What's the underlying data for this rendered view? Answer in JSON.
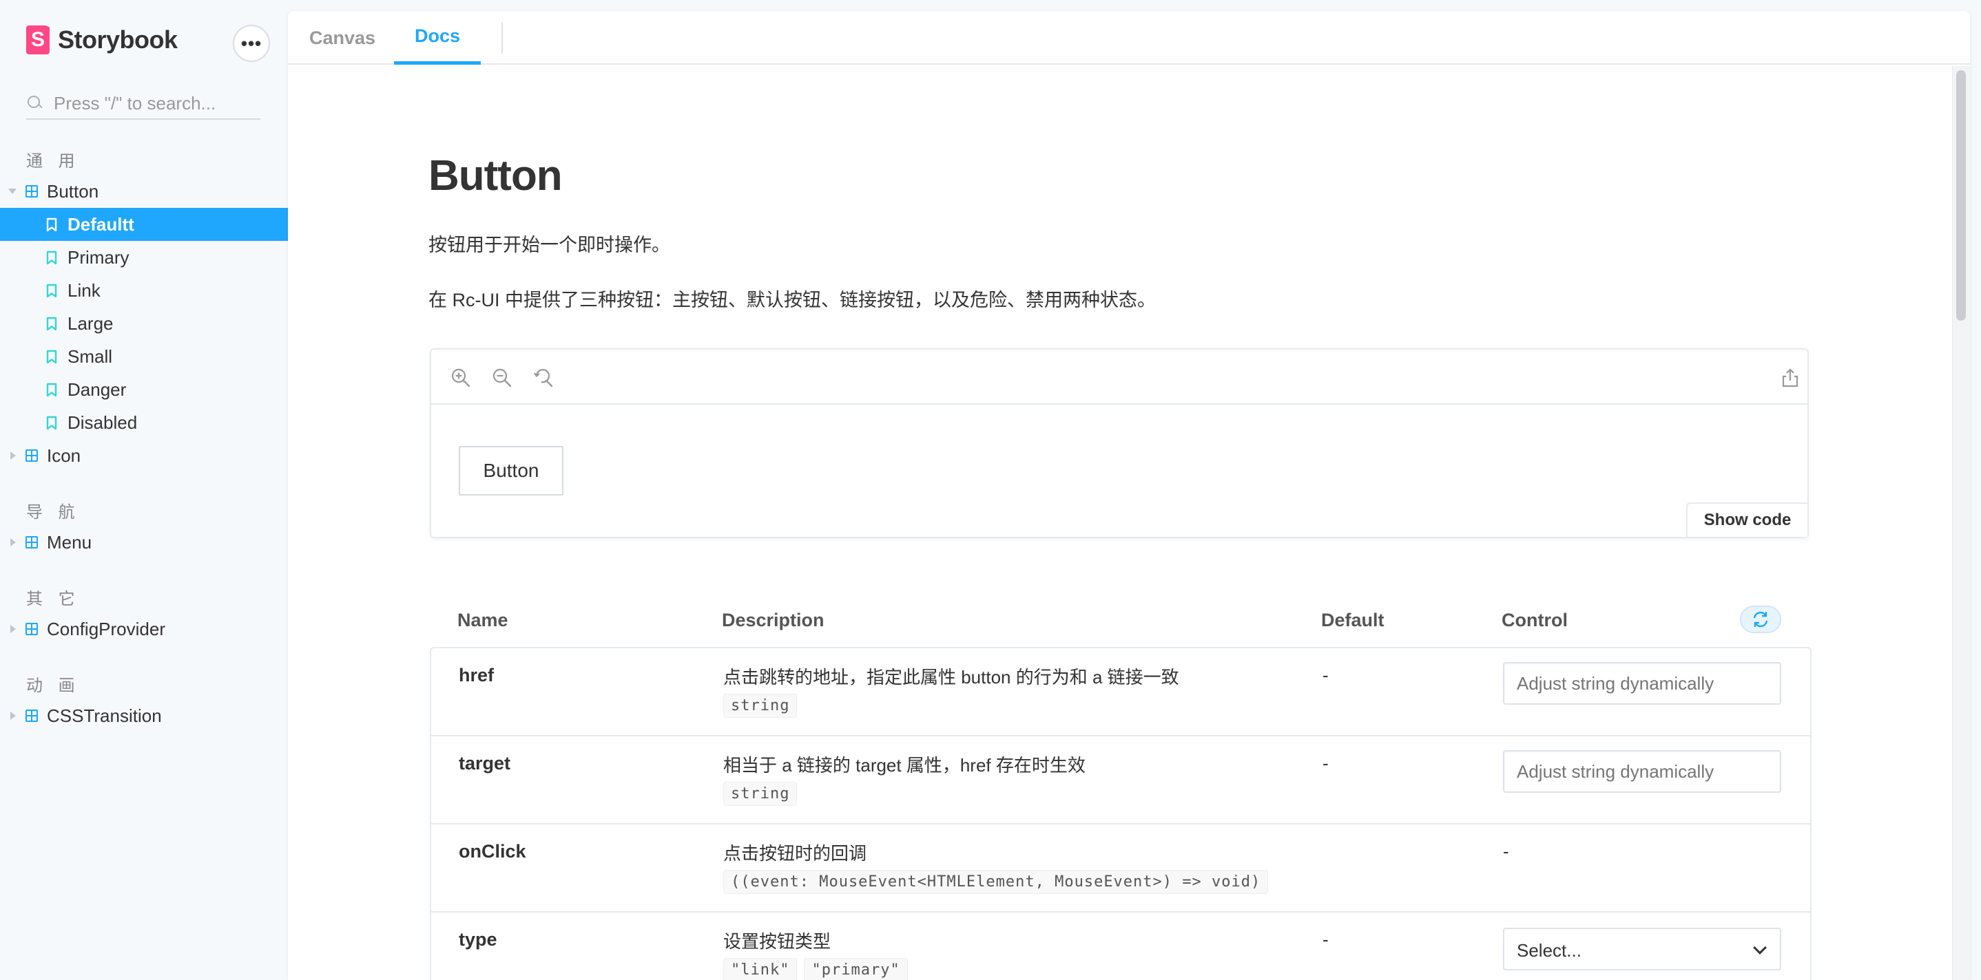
{
  "app": {
    "brand": "Storybook",
    "brand_letter": "S"
  },
  "sidebar": {
    "search_placeholder": "Press \"/\" to search...",
    "sections": [
      {
        "title": "通 用"
      },
      {
        "title": "导 航"
      },
      {
        "title": "其 它"
      },
      {
        "title": "动 画"
      }
    ],
    "components": {
      "button": "Button",
      "icon": "Icon",
      "menu": "Menu",
      "config": "ConfigProvider",
      "css": "CSSTransition"
    },
    "stories": [
      "Defaultt",
      "Primary",
      "Link",
      "Large",
      "Small",
      "Danger",
      "Disabled"
    ],
    "active_story": "Defaultt"
  },
  "tabs": {
    "canvas": "Canvas",
    "docs": "Docs",
    "active": "Docs"
  },
  "doc": {
    "title": "Button",
    "paragraph1": "按钮用于开始一个即时操作。",
    "paragraph2": "在 Rc-UI 中提供了三种按钮：主按钮、默认按钮、链接按钮，以及危险、禁用两种状态。",
    "preview_button_label": "Button",
    "show_code_label": "Show code"
  },
  "props_table": {
    "headers": {
      "name": "Name",
      "description": "Description",
      "default": "Default",
      "control": "Control"
    },
    "rows": [
      {
        "name": "href",
        "description": "点击跳转的地址，指定此属性 button 的行为和 a 链接一致",
        "type": "string",
        "default": "-",
        "control_placeholder": "Adjust string dynamically"
      },
      {
        "name": "target",
        "description": "相当于 a 链接的 target 属性，href 存在时生效",
        "type": "string",
        "default": "-",
        "control_placeholder": "Adjust string dynamically"
      },
      {
        "name": "onClick",
        "description": "点击按钮时的回调",
        "type": "((event: MouseEvent<HTMLElement, MouseEvent>) => void)",
        "default": "",
        "control": "-"
      },
      {
        "name": "type",
        "description": "设置按钮类型",
        "type_values": [
          "\"link\"",
          "\"primary\""
        ],
        "default": "-",
        "control_select": "Select..."
      }
    ]
  },
  "colors": {
    "accent": "#1ea7fd",
    "brand": "#ff4785",
    "story_icon": "#37d5d3"
  }
}
